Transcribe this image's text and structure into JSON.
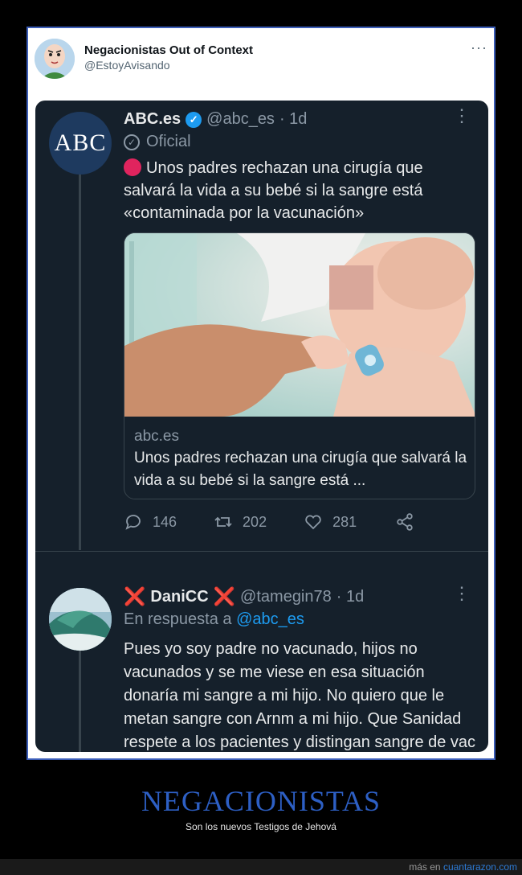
{
  "outer_tweet": {
    "name": "Negacionistas Out of Context",
    "handle": "@EstoyAvisando",
    "more": "···"
  },
  "tweet1": {
    "avatar_text": "ABC",
    "name": "ABC.es",
    "handle": "@abc_es",
    "time": "· 1d",
    "badge_label": "Oficial",
    "text": "Unos padres rechazan una cirugía que salvará la vida a su bebé si la sangre está «contaminada por la vacunación»",
    "card": {
      "domain": "abc.es",
      "title": "Unos padres rechazan una cirugía que salvará la vida a su bebé si la sangre está ..."
    },
    "stats": {
      "replies": "146",
      "retweets": "202",
      "likes": "281"
    }
  },
  "tweet2": {
    "name": "DaniCC",
    "name_prefix": "❌",
    "name_suffix": "❌",
    "handle": "@tamegin78",
    "time": "· 1d",
    "reply_prefix": "En respuesta a",
    "reply_mention": "@abc_es",
    "text": "Pues yo soy padre no vacunado, hijos no vacunados y se me viese en esa situación donaría mi sangre a mi hijo. No quiero que le metan sangre con Arnm a mi hijo. Que Sanidad respete a los pacientes y distingan sangre de vac y novac."
  },
  "footer": {
    "title": "NEGACIONISTAS",
    "subtitle": "Son los nuevos Testigos de Jehová",
    "more_prefix": "más en",
    "more_link": "cuantarazon.com"
  },
  "colors": {
    "accent": "#1d9bf0",
    "dark_bg": "#15202b",
    "footer_title": "#2d5fc4",
    "red": "#e0245e"
  }
}
